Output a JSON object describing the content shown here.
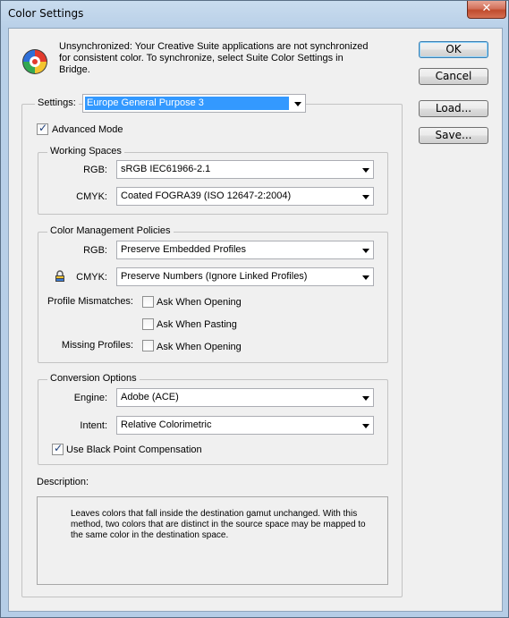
{
  "window": {
    "title": "Color Settings",
    "close_glyph": "✕"
  },
  "info": {
    "icon": "color-wheel-icon",
    "message_line1": "Unsynchronized: Your Creative Suite applications are not synchronized",
    "message_line2": "for consistent color. To synchronize, select Suite Color Settings in",
    "message_line3": "Bridge."
  },
  "buttons": {
    "ok": "OK",
    "cancel": "Cancel",
    "load": "Load...",
    "save": "Save..."
  },
  "settings": {
    "label": "Settings:",
    "value": "Europe General Purpose 3",
    "advanced_mode_label": "Advanced Mode",
    "advanced_mode_checked": true
  },
  "working_spaces": {
    "title": "Working Spaces",
    "rgb_label": "RGB:",
    "rgb_value": "sRGB IEC61966-2.1",
    "cmyk_label": "CMYK:",
    "cmyk_value": "Coated FOGRA39 (ISO 12647-2:2004)"
  },
  "policies": {
    "title": "Color Management Policies",
    "rgb_label": "RGB:",
    "rgb_value": "Preserve Embedded Profiles",
    "cmyk_label": "CMYK:",
    "cmyk_value": "Preserve Numbers (Ignore Linked Profiles)",
    "lock_icon": "padlock-icon",
    "mismatch_label": "Profile Mismatches:",
    "ask_opening_label": "Ask When Opening",
    "ask_pasting_label": "Ask When Pasting",
    "missing_label": "Missing Profiles:",
    "missing_ask_opening_label": "Ask When Opening"
  },
  "conversion": {
    "title": "Conversion Options",
    "engine_label": "Engine:",
    "engine_value": "Adobe (ACE)",
    "intent_label": "Intent:",
    "intent_value": "Relative Colorimetric",
    "bpc_label": "Use Black Point Compensation",
    "bpc_checked": true
  },
  "description": {
    "label": "Description:",
    "line1": "Leaves colors that fall inside the destination gamut unchanged. With this",
    "line2": "method, two colors that are distinct in the source space may be mapped to",
    "line3": "the same color in the destination space."
  }
}
